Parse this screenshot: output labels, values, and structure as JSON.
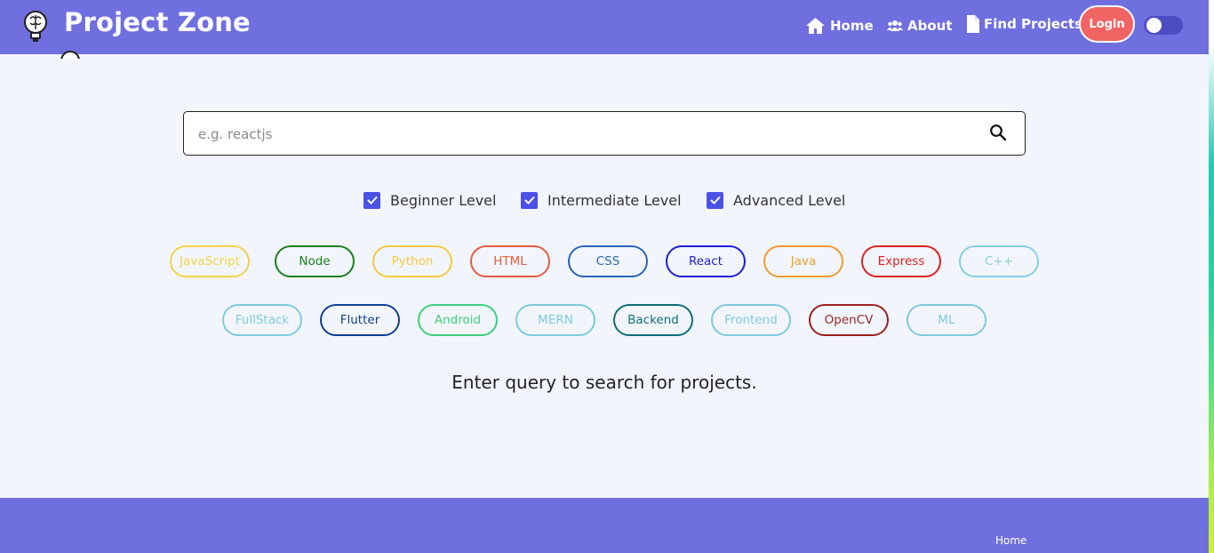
{
  "navbar": {
    "title": "Project Zone",
    "links": [
      {
        "label": "Home",
        "icon": "home-icon"
      },
      {
        "label": "About",
        "icon": "users-icon"
      },
      {
        "label": "Find Projects",
        "icon": "file-icon"
      }
    ],
    "login_label": "Login",
    "theme_toggle_on": false,
    "colors": {
      "bar": "#6f6fdf",
      "login": "#f26363",
      "toggle": "#4d4dc2"
    }
  },
  "search": {
    "placeholder": "e.g. reactjs",
    "value": "",
    "icon": "search-icon"
  },
  "levels": [
    {
      "label": "Beginner Level",
      "checked": true
    },
    {
      "label": "Intermediate Level",
      "checked": true
    },
    {
      "label": "Advanced Level",
      "checked": true
    }
  ],
  "tags": [
    {
      "label": "JavaScript",
      "color": "#f2d24b"
    },
    {
      "label": "Node",
      "color": "#1a7f1a"
    },
    {
      "label": "Python",
      "color": "#f5c842"
    },
    {
      "label": "HTML",
      "color": "#e35b3f"
    },
    {
      "label": "CSS",
      "color": "#2965b5"
    },
    {
      "label": "React",
      "color": "#1f1fd6"
    },
    {
      "label": "Java",
      "color": "#f29a2e"
    },
    {
      "label": "Express",
      "color": "#e01f1f"
    },
    {
      "label": "C++",
      "color": "#86cfe3"
    },
    {
      "label": "FullStack",
      "color": "#7ec9df"
    },
    {
      "label": "Flutter",
      "color": "#0f3f8f"
    },
    {
      "label": "Android",
      "color": "#3cd07a"
    },
    {
      "label": "MERN",
      "color": "#7ec9df"
    },
    {
      "label": "Backend",
      "color": "#0f6e7a"
    },
    {
      "label": "Frontend",
      "color": "#7ec9df"
    },
    {
      "label": "OpenCV",
      "color": "#9e1f1f"
    },
    {
      "label": "ML",
      "color": "#7ec9df"
    }
  ],
  "message": "Enter query to search for projects.",
  "footer": {
    "links": [
      "Home"
    ]
  }
}
